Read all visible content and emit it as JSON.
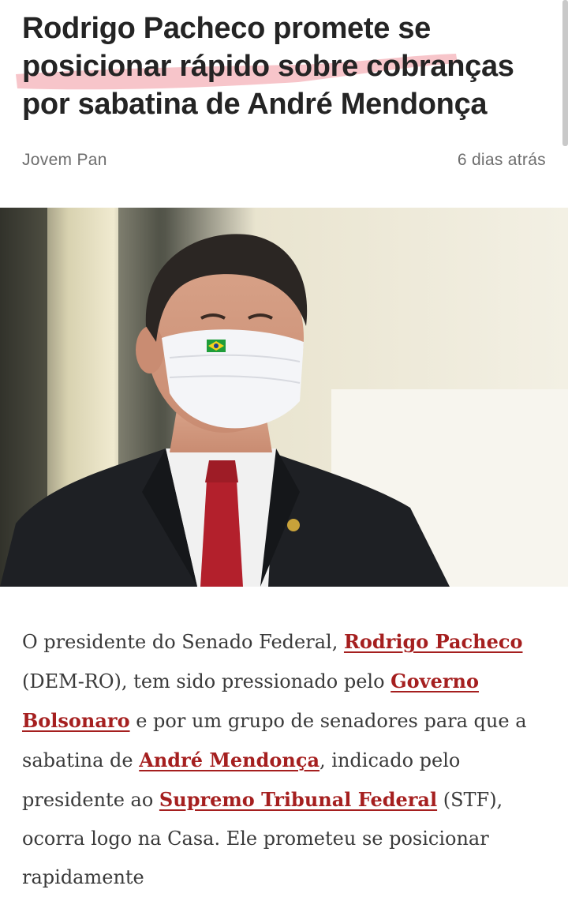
{
  "article": {
    "title": "Rodrigo Pacheco promete se posicionar rápido sobre cobranças por sabatina de André Mendonça",
    "source": "Jovem Pan",
    "time": "6 dias atrás"
  },
  "image": {
    "subject": "portrait-photo"
  },
  "body": {
    "t1": "O presidente do Senado Federal, ",
    "link1": "Rodrigo Pacheco",
    "t2": " (DEM-RO), tem sido pressionado pelo ",
    "link2": "Governo Bolsonaro",
    "t3": " e por um grupo de senadores para que a sabatina de ",
    "link3": "André Mendonça",
    "t4": ", indicado pelo presidente ao ",
    "link4": "Supremo Tribunal Federal",
    "t5": " (STF), ocorra logo na Casa. Ele prometeu se posicionar rapidamente"
  },
  "colors": {
    "link": "#a51f1f",
    "highlight": "#f2a6ad"
  }
}
